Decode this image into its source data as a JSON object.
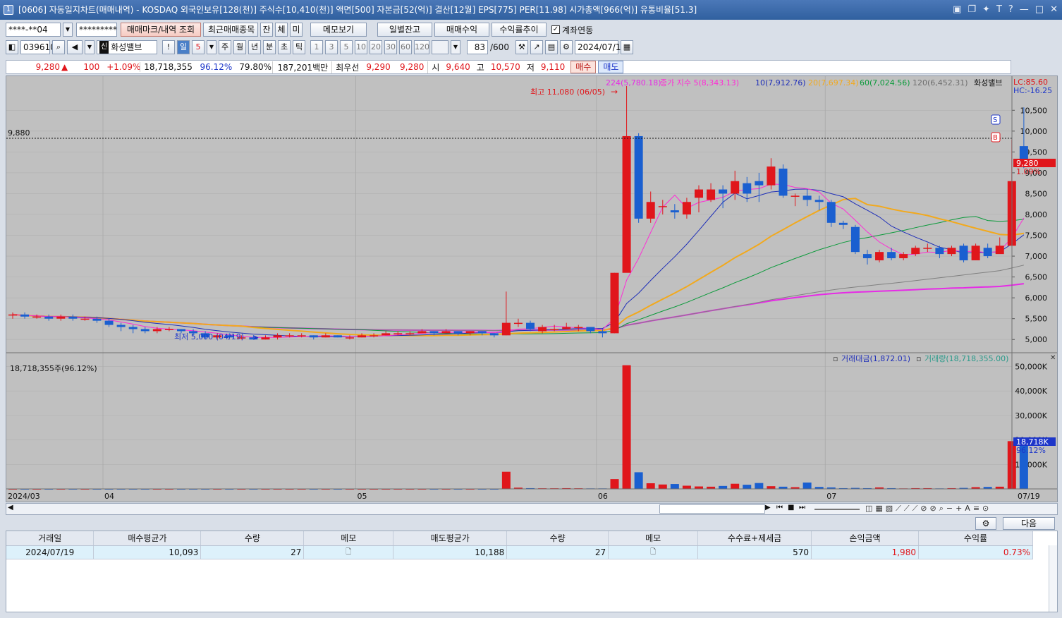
{
  "window": {
    "icon_label": "1",
    "title": "[0606] 자동일지차트(매매내역) - KOSDAQ 외국인보유[128(천)] 주식수[10,410(천)] 액면[500] 자본금[52(억)] 결산[12월] EPS[775] PER[11.98] 시가총액[966(억)] 유통비율[51.3]"
  },
  "toolbar1": {
    "account": "****-**04",
    "password": "*********",
    "mark_button": "매매마크/내역 조회",
    "recent_button": "최근매매종목",
    "tab1": "잔",
    "tab2": "체",
    "tab3": "미",
    "memo_button": "메모보기",
    "daily_balance_button": "일별잔고",
    "trade_profit_button": "매매수익",
    "profit_trend_button": "수익률추이",
    "account_link_label": "계좌연동"
  },
  "toolbar2": {
    "code": "039610",
    "stock_name": "화성밸브",
    "badge": "신",
    "info": "!",
    "period_day": "일",
    "period_n": "5",
    "period_week": "주",
    "period_month": "월",
    "period_year": "년",
    "period_min": "분",
    "period_sec": "초",
    "period_tick": "틱",
    "n1": "1",
    "n2": "3",
    "n3": "5",
    "n4": "10",
    "n5": "20",
    "n6": "30",
    "n7": "60",
    "n8": "120",
    "count": "83",
    "count_max": "/600",
    "date": "2024/07/19"
  },
  "quote": {
    "price": "9,280",
    "arrow": "▲",
    "change": "100",
    "change_pct": "+1.09%",
    "volume": "18,718,355",
    "vol_ratio": "96.12%",
    "pct2": "79.80%",
    "amount": "187,201백만",
    "best_bid_label": "최우선",
    "best_ask": "9,290",
    "best_bid": "9,280",
    "open_label": "시",
    "open": "9,640",
    "high_label": "고",
    "high": "10,570",
    "low_label": "저",
    "low": "9,110",
    "buy_button": "매수",
    "sell_button": "매도"
  },
  "price_panel": {
    "ma224": "224(5,780.18)",
    "close_index": "종가 지수 5(8,343.13)",
    "ma10": "10(7,912.76)",
    "ma20": "20(7,697.34)",
    "ma60": "60(7,024.56)",
    "ma120": "120(6,452.31)",
    "stock_label": "화성밸브",
    "lc": "LC:85.60",
    "hc": "HC:-16.25",
    "high_note": "최고 11,080 (06/05)",
    "low_note": "최저 5,000 (04/19)",
    "ref_line_label": "9,880",
    "current_price_tag": "9,280",
    "current_pct_tag": "1.09%",
    "marker_buy": "S",
    "marker_sell": "B"
  },
  "volume_panel": {
    "info": "18,718,355주(96.12%)",
    "legend_amount": "거래대금(1,872.01)",
    "legend_volume": "거래량(18,718,355.00)",
    "tag_volume": "18,718K",
    "tag_pct": "96.12%"
  },
  "x_axis": {
    "start_label": "2024/03",
    "end_label": "07/19",
    "month_labels": [
      "04",
      "05",
      "06",
      "07"
    ]
  },
  "colors": {
    "up": "#e0161b",
    "down": "#1a5fd0",
    "ma5": "#ff2bd6",
    "ma10": "#1f2fb8",
    "ma20": "#f2a91d",
    "ma60": "#0a9a3a",
    "ma120": "#808080",
    "ma224": "#e62be6"
  },
  "chart_data": {
    "type": "candlestick",
    "price_axis": {
      "ticks": [
        "5,000",
        "5,500",
        "6,000",
        "6,500",
        "7,000",
        "7,500",
        "8,000",
        "8,500",
        "9,000",
        "9,500",
        "10,000",
        "10,500"
      ],
      "range": [
        4750,
        11250
      ]
    },
    "volume_axis": {
      "ticks": [
        "10,000K",
        "20,000K",
        "30,000K",
        "40,000K",
        "50,000K"
      ],
      "range": [
        0,
        51000
      ]
    },
    "candles": [
      [
        5600,
        5600,
        5650,
        5500,
        1
      ],
      [
        5600,
        5550,
        5650,
        5500,
        1
      ],
      [
        5550,
        5550,
        5600,
        5500,
        1
      ],
      [
        5550,
        5500,
        5600,
        5450,
        1
      ],
      [
        5500,
        5550,
        5600,
        5450,
        1
      ],
      [
        5550,
        5500,
        5600,
        5450,
        1
      ],
      [
        5500,
        5500,
        5550,
        5450,
        1
      ],
      [
        5500,
        5450,
        5550,
        5400,
        1
      ],
      [
        5450,
        5350,
        5500,
        5300,
        1
      ],
      [
        5350,
        5300,
        5400,
        5200,
        1
      ],
      [
        5300,
        5250,
        5350,
        5150,
        1
      ],
      [
        5250,
        5200,
        5300,
        5150,
        1
      ],
      [
        5200,
        5250,
        5300,
        5150,
        1
      ],
      [
        5250,
        5250,
        5300,
        5200,
        1
      ],
      [
        5250,
        5200,
        5250,
        5150,
        1
      ],
      [
        5200,
        5150,
        5250,
        5100,
        1
      ],
      [
        5150,
        5050,
        5200,
        5000,
        1
      ],
      [
        5050,
        5100,
        5150,
        5000,
        1
      ],
      [
        5100,
        5050,
        5150,
        5000,
        1
      ],
      [
        5050,
        5050,
        5100,
        5000,
        1
      ],
      [
        5050,
        5000,
        5100,
        5000,
        1
      ],
      [
        5000,
        5050,
        5100,
        5000,
        1
      ],
      [
        5050,
        5100,
        5150,
        5000,
        1
      ],
      [
        5100,
        5100,
        5150,
        5050,
        1
      ],
      [
        5100,
        5100,
        5150,
        5050,
        1
      ],
      [
        5100,
        5050,
        5100,
        5000,
        1
      ],
      [
        5050,
        5100,
        5150,
        5050,
        1
      ],
      [
        5100,
        5050,
        5100,
        5050,
        1
      ],
      [
        5050,
        5050,
        5100,
        5000,
        1
      ],
      [
        5050,
        5100,
        5150,
        5050,
        1
      ],
      [
        5100,
        5100,
        5150,
        5050,
        1
      ],
      [
        5100,
        5150,
        5200,
        5100,
        1
      ],
      [
        5150,
        5150,
        5200,
        5100,
        1
      ],
      [
        5150,
        5150,
        5200,
        5100,
        1
      ],
      [
        5150,
        5200,
        5250,
        5150,
        1
      ],
      [
        5200,
        5150,
        5200,
        5100,
        1
      ],
      [
        5150,
        5200,
        5250,
        5150,
        1
      ],
      [
        5200,
        5150,
        5200,
        5100,
        1
      ],
      [
        5150,
        5200,
        5200,
        5100,
        1
      ],
      [
        5200,
        5150,
        5200,
        5100,
        1
      ],
      [
        5150,
        5100,
        5150,
        5050,
        1
      ],
      [
        5100,
        5400,
        6150,
        5100,
        7000
      ],
      [
        5400,
        5400,
        5500,
        5300,
        500
      ],
      [
        5400,
        5250,
        5450,
        5200,
        300
      ],
      [
        5200,
        5300,
        5350,
        5150,
        250
      ],
      [
        5250,
        5250,
        5350,
        5200,
        250
      ],
      [
        5250,
        5300,
        5400,
        5250,
        300
      ],
      [
        5300,
        5300,
        5350,
        5200,
        250
      ],
      [
        5300,
        5200,
        5300,
        5150,
        200
      ],
      [
        5200,
        5150,
        5250,
        5050,
        200
      ],
      [
        5150,
        6600,
        6600,
        5150,
        4000
      ],
      [
        6600,
        9880,
        11080,
        7700,
        50500
      ],
      [
        9880,
        7900,
        9950,
        7800,
        6800
      ],
      [
        7900,
        8300,
        8550,
        7800,
        2300
      ],
      [
        8200,
        8200,
        8350,
        8000,
        1800
      ],
      [
        8100,
        8050,
        8250,
        7900,
        2000
      ],
      [
        8000,
        8300,
        8400,
        7900,
        1300
      ],
      [
        8400,
        8600,
        8700,
        8050,
        1000
      ],
      [
        8350,
        8600,
        8750,
        8300,
        900
      ],
      [
        8600,
        8500,
        8700,
        8150,
        1200
      ],
      [
        8500,
        8800,
        9050,
        8350,
        2100
      ],
      [
        8750,
        8500,
        8900,
        8300,
        1700
      ],
      [
        8800,
        8700,
        9000,
        8300,
        2400
      ],
      [
        8700,
        9150,
        9350,
        8600,
        1100
      ],
      [
        9100,
        8450,
        9200,
        8400,
        900
      ],
      [
        8450,
        8450,
        8500,
        8200,
        700
      ],
      [
        8450,
        8350,
        8600,
        8200,
        2600
      ],
      [
        8350,
        8300,
        8450,
        8100,
        800
      ],
      [
        8300,
        7800,
        8350,
        7700,
        600
      ],
      [
        7800,
        7750,
        7850,
        7650,
        300
      ],
      [
        7700,
        7100,
        7750,
        7050,
        400
      ],
      [
        7050,
        6950,
        7150,
        6800,
        300
      ],
      [
        6900,
        7100,
        7150,
        6850,
        600
      ],
      [
        7100,
        6950,
        7200,
        6900,
        300
      ],
      [
        6950,
        7050,
        7100,
        6900,
        200
      ],
      [
        7050,
        7200,
        7250,
        7000,
        300
      ],
      [
        7200,
        7200,
        7300,
        7100,
        300
      ],
      [
        7200,
        7050,
        7250,
        6950,
        200
      ],
      [
        7050,
        7200,
        7250,
        7000,
        300
      ],
      [
        7250,
        6900,
        7300,
        6850,
        400
      ],
      [
        6900,
        7250,
        7300,
        6900,
        700
      ],
      [
        7200,
        7000,
        7300,
        6950,
        800
      ],
      [
        7050,
        7250,
        7450,
        7100,
        900
      ],
      [
        7250,
        8800,
        9800,
        7250,
        19500
      ],
      [
        9640,
        9280,
        10570,
        9110,
        18718
      ]
    ]
  },
  "bottom_toolbar": {
    "next_button": "다음"
  },
  "table": {
    "headers": [
      "거래일",
      "매수평균가",
      "수량",
      "메모",
      "매도평균가",
      "수량",
      "메모",
      "수수료+제세금",
      "손익금액",
      "수익률"
    ],
    "row": {
      "date": "2024/07/19",
      "buy_avg": "10,093",
      "buy_qty": "27",
      "memo1": "",
      "sell_avg": "10,188",
      "sell_qty": "27",
      "memo2": "",
      "fee": "570",
      "pnl": "1,980",
      "ret": "0.73%"
    }
  }
}
